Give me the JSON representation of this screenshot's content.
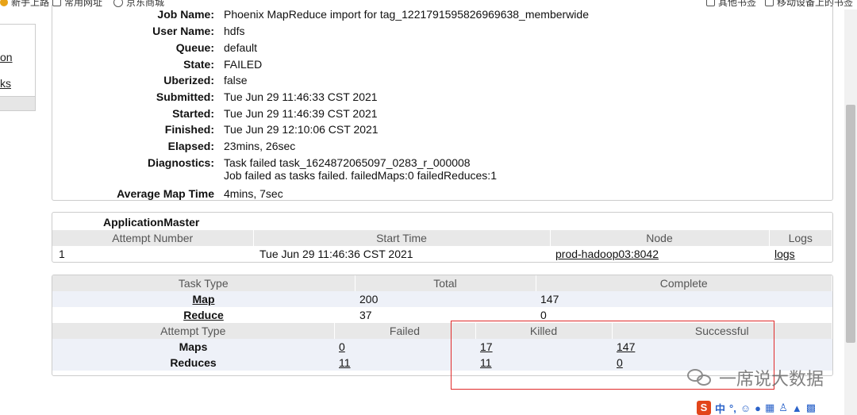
{
  "bookmarks": {
    "items": [
      "新手上路",
      "常用网址",
      "京东商城"
    ],
    "right_items": [
      "其他书签",
      "移动设备上的书签"
    ]
  },
  "sidebar": {
    "links": [
      "on",
      "ks"
    ]
  },
  "job": {
    "rows": [
      {
        "label": "Job Name:",
        "value": "Phoenix MapReduce import for tag_1221791595826969638_memberwide"
      },
      {
        "label": "User Name:",
        "value": "hdfs"
      },
      {
        "label": "Queue:",
        "value": "default"
      },
      {
        "label": "State:",
        "value": "FAILED"
      },
      {
        "label": "Uberized:",
        "value": "false"
      },
      {
        "label": "Submitted:",
        "value": "Tue Jun 29 11:46:33 CST 2021"
      },
      {
        "label": "Started:",
        "value": "Tue Jun 29 11:46:39 CST 2021"
      },
      {
        "label": "Finished:",
        "value": "Tue Jun 29 12:10:06 CST 2021"
      },
      {
        "label": "Elapsed:",
        "value": "23mins, 26sec"
      },
      {
        "label": "Diagnostics:",
        "value": "Task failed task_1624872065097_0283_r_000008",
        "value2": "Job failed as tasks failed. failedMaps:0 failedReduces:1"
      },
      {
        "label": "Average Map Time",
        "value": "4mins, 7sec"
      }
    ]
  },
  "am": {
    "title": "ApplicationMaster",
    "headers": [
      "Attempt Number",
      "Start Time",
      "Node",
      "Logs"
    ],
    "row": {
      "attempt": "1",
      "start": "Tue Jun 29 11:46:36 CST 2021",
      "node": "prod-hadoop03:8042",
      "logs": "logs"
    }
  },
  "tasks": {
    "headers": [
      "Task Type",
      "Total",
      "Complete"
    ],
    "rows": [
      {
        "type": "Map",
        "total": "200",
        "complete": "147"
      },
      {
        "type": "Reduce",
        "total": "37",
        "complete": "0"
      }
    ],
    "attempt_headers": [
      "Attempt Type",
      "Failed",
      "Killed",
      "Successful"
    ],
    "attempt_rows": [
      {
        "type": "Maps",
        "failed": "0",
        "killed": "17",
        "successful": "147"
      },
      {
        "type": "Reduces",
        "failed": "11",
        "killed": "11",
        "successful": "0"
      }
    ]
  },
  "watermark": {
    "text": "一席说大数据"
  },
  "ime": {
    "lang": "中"
  },
  "colors": {
    "highlight_box": "#e02b2b",
    "header_bg": "#e8e8e8",
    "stripe_bg": "#eef1f8"
  }
}
